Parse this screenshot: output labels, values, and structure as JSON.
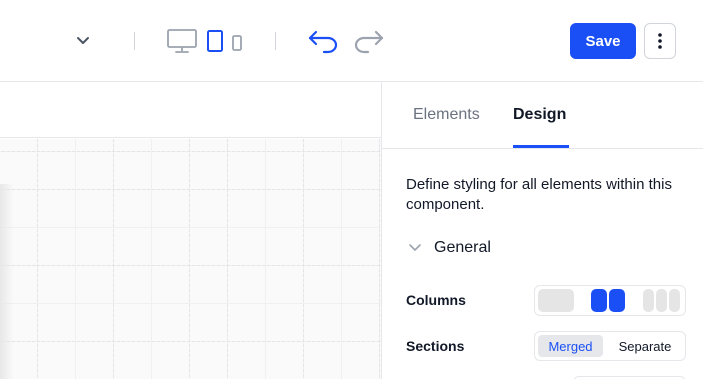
{
  "toolbar": {
    "icons": {
      "dropdown": "chevron-down-icon",
      "desktop": "desktop-icon",
      "tablet": "tablet-icon",
      "mobile": "mobile-icon",
      "undo": "undo-icon",
      "redo": "redo-icon",
      "more": "more-vertical-icon"
    },
    "active_device": "tablet",
    "save_label": "Save"
  },
  "panel": {
    "tabs": [
      {
        "label": "Elements",
        "active": false
      },
      {
        "label": "Design",
        "active": true
      }
    ],
    "description": "Define styling for all elements within this component.",
    "general_section": {
      "label": "General",
      "icon": "chevron-down-icon",
      "columns": {
        "label": "Columns",
        "options": [
          1,
          2,
          3
        ],
        "selected": 2
      },
      "sections": {
        "label": "Sections",
        "options": [
          "Merged",
          "Separate"
        ],
        "selected": "Merged"
      }
    }
  },
  "colors": {
    "accent": "#1a4ff5",
    "inactive_icon": "#9ca3af",
    "toolbar_icon": "#4b5563"
  }
}
